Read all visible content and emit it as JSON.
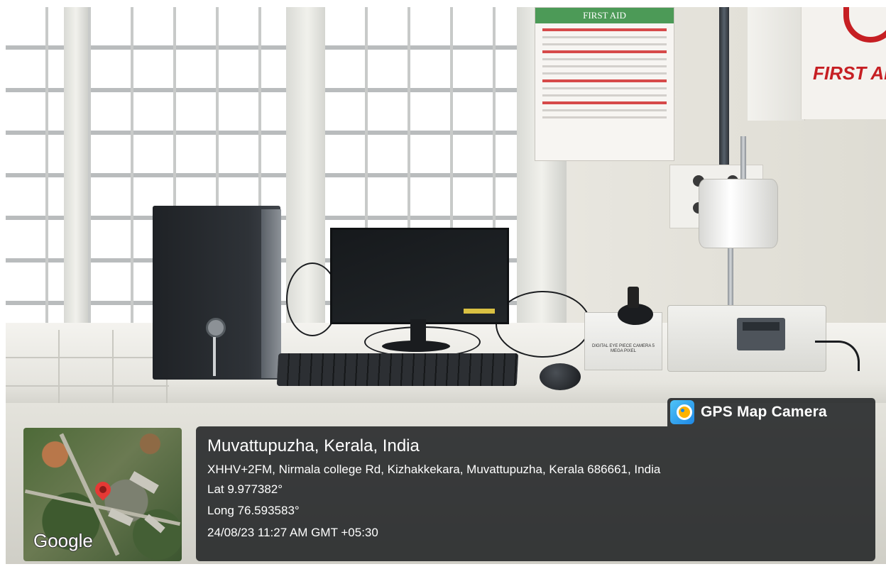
{
  "photo": {
    "poster_title": "FIRST AID",
    "first_aid_label": "FIRST AID B",
    "camera_box_text": "DIGITAL EYE PIECE CAMERA 5 MEGA PIXEL"
  },
  "overlay": {
    "app_name": "GPS Map Camera",
    "place": "Muvattupuzha, Kerala, India",
    "address": "XHHV+2FM, Nirmala college Rd, Kizhakkekara, Muvattupuzha, Kerala 686661, India",
    "latitude": "Lat 9.977382°",
    "longitude": "Long 76.593583°",
    "datetime": "24/08/23 11:27 AM GMT +05:30",
    "map_attribution": "Google",
    "accent_color": "#1e88e5",
    "pin_color": "#e53935"
  }
}
